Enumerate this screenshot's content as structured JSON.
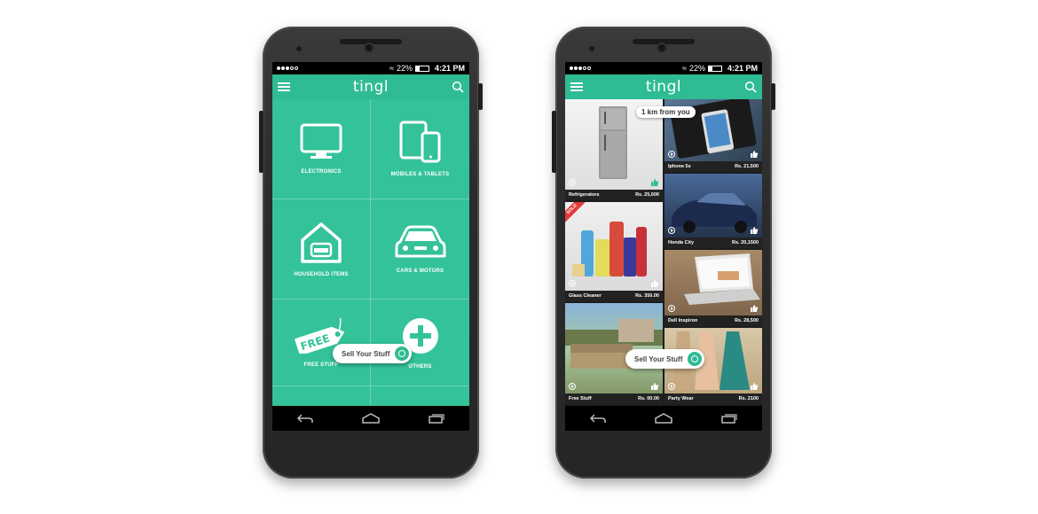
{
  "status": {
    "battery": "22%",
    "time": "4:21 PM"
  },
  "app": {
    "logo": "tingl"
  },
  "categories": [
    {
      "label": "ELECTRONICS",
      "icon": "monitor-icon"
    },
    {
      "label": "MOBILES & TABLETS",
      "icon": "devices-icon"
    },
    {
      "label": "HOUSEHOLD ITEMS",
      "icon": "house-sofa-icon"
    },
    {
      "label": "CARS & MOTORS",
      "icon": "car-icon"
    },
    {
      "label": "FREE STUFF",
      "icon": "free-tag-icon"
    },
    {
      "label": "OTHERS",
      "icon": "plus-circle-icon"
    }
  ],
  "free_tag": "FREE",
  "sell_label": "Sell Your Stuff",
  "distance_badge": "1 km from you",
  "sold_label": "SOLD",
  "listings_left": [
    {
      "name": "Refrigerators",
      "price": "Rs. 25,000"
    },
    {
      "name": "Glass Cleaner",
      "price": "Rs. 350.00"
    },
    {
      "name": "Free Stuff",
      "price": "Rs. 00.00"
    }
  ],
  "listings_right": [
    {
      "name": "Iphone 5s",
      "price": "Rs. 21,500"
    },
    {
      "name": "Honda City",
      "price": "Rs. 20,1500"
    },
    {
      "name": "Dell Inspiron",
      "price": "Rs. 28,500"
    },
    {
      "name": "Party Wear",
      "price": "Rs. 2100"
    }
  ],
  "colors": {
    "accent": "#2fbb93",
    "grid": "#34c29a",
    "sold": "#e53a3a"
  }
}
